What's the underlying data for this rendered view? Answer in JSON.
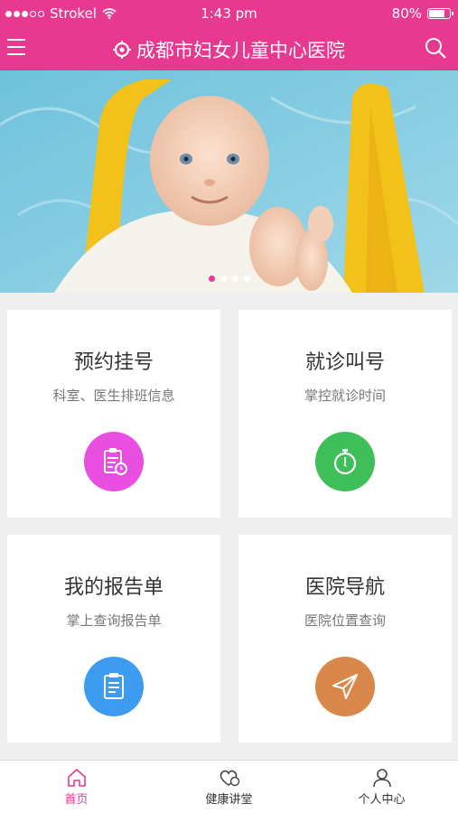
{
  "status": {
    "carrier": "Strokel",
    "time": "1:43 pm",
    "battery": "80%",
    "battery_level": 0.8
  },
  "header": {
    "title": "成都市妇女儿童中心医院"
  },
  "banner": {
    "page_count": 4,
    "active_index": 0
  },
  "cards": [
    {
      "title": "预约挂号",
      "subtitle": "科室、医生排班信息",
      "icon": "clipboard-clock-icon",
      "color": "#e84fe0"
    },
    {
      "title": "就诊叫号",
      "subtitle": "掌控就诊时间",
      "icon": "stopwatch-icon",
      "color": "#3fbf5a"
    },
    {
      "title": "我的报告单",
      "subtitle": "掌上查询报告单",
      "icon": "report-icon",
      "color": "#3d9bf0"
    },
    {
      "title": "医院导航",
      "subtitle": "医院位置查询",
      "icon": "navigation-icon",
      "color": "#d9874b"
    }
  ],
  "tabs": [
    {
      "label": "首页",
      "icon": "home-icon",
      "active": true
    },
    {
      "label": "健康讲堂",
      "icon": "heart-chat-icon",
      "active": false
    },
    {
      "label": "个人中心",
      "icon": "person-icon",
      "active": false
    }
  ],
  "colors": {
    "brand": "#e6398f"
  }
}
